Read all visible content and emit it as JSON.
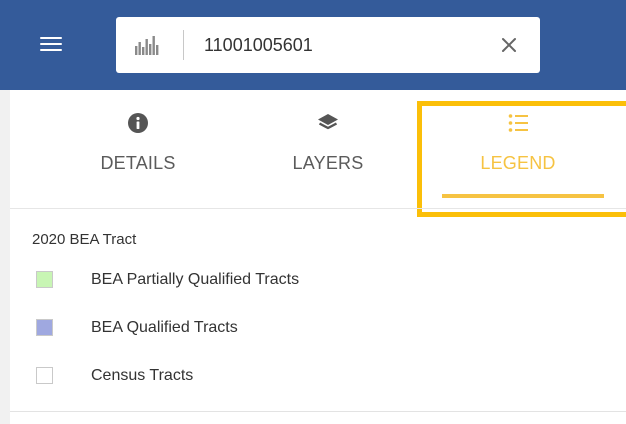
{
  "colors": {
    "header_bg": "#345b9a",
    "accent": "#f6c342",
    "highlight_box": "#fbbf09"
  },
  "header": {
    "menu_icon": "hamburger-menu-icon",
    "search": {
      "icon": "bar-chart-icon",
      "value": "11001005601",
      "clear_icon": "close-icon"
    }
  },
  "tabs": [
    {
      "label": "DETAILS",
      "icon": "info-circle-icon",
      "active": false
    },
    {
      "label": "LAYERS",
      "icon": "layers-icon",
      "active": false
    },
    {
      "label": "LEGEND",
      "icon": "list-icon",
      "active": true
    }
  ],
  "legend": {
    "title": "2020 BEA Tract",
    "items": [
      {
        "label": "BEA Partially Qualified Tracts",
        "color": "#c8f5b4"
      },
      {
        "label": "BEA Qualified Tracts",
        "color": "#9fa8e0"
      },
      {
        "label": "Census Tracts",
        "color": "#ffffff"
      }
    ]
  }
}
